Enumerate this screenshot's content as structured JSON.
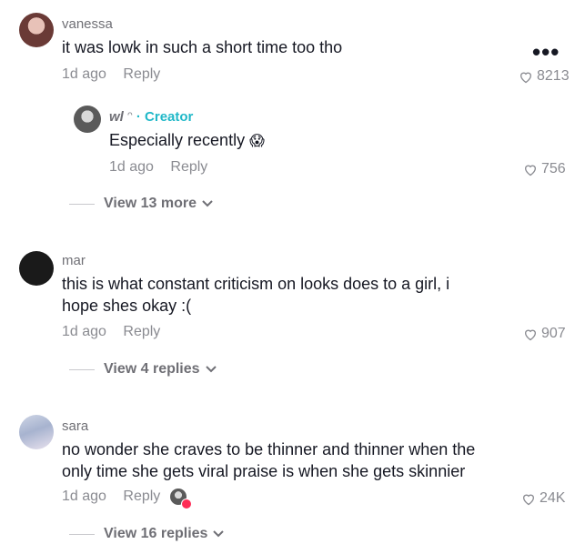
{
  "comments": [
    {
      "username": "vanessa",
      "text": "it was lowk in such a short time too tho",
      "time": "1d ago",
      "reply_label": "Reply",
      "likes": "8213",
      "reply": {
        "username": "wl",
        "creator_label": "· Creator",
        "text": "Especially recently",
        "emoji": "😱",
        "time": "1d ago",
        "reply_label": "Reply",
        "likes": "756"
      },
      "view_more": "View 13 more"
    },
    {
      "username": "mar",
      "text_line1": "this is what constant criticism on looks does to a girl, i",
      "text_line2": "hope shes okay :(",
      "time": "1d ago",
      "reply_label": "Reply",
      "likes": "907",
      "view_more": "View 4 replies"
    },
    {
      "username": "sara",
      "text_line1": "no wonder she craves to be thinner and thinner when the",
      "text_line2": "only time she gets viral praise is when she gets skinnier",
      "time": "1d ago",
      "reply_label": "Reply",
      "likes": "24K",
      "view_more": "View 16 replies"
    }
  ],
  "more_options_icon": "more-horizontal-icon",
  "heart_icon": "heart-outline-icon",
  "chevron_icon": "chevron-down-icon",
  "colors": {
    "creator": "#20b8c8",
    "muted": "#8a8b91",
    "text": "#161823"
  }
}
